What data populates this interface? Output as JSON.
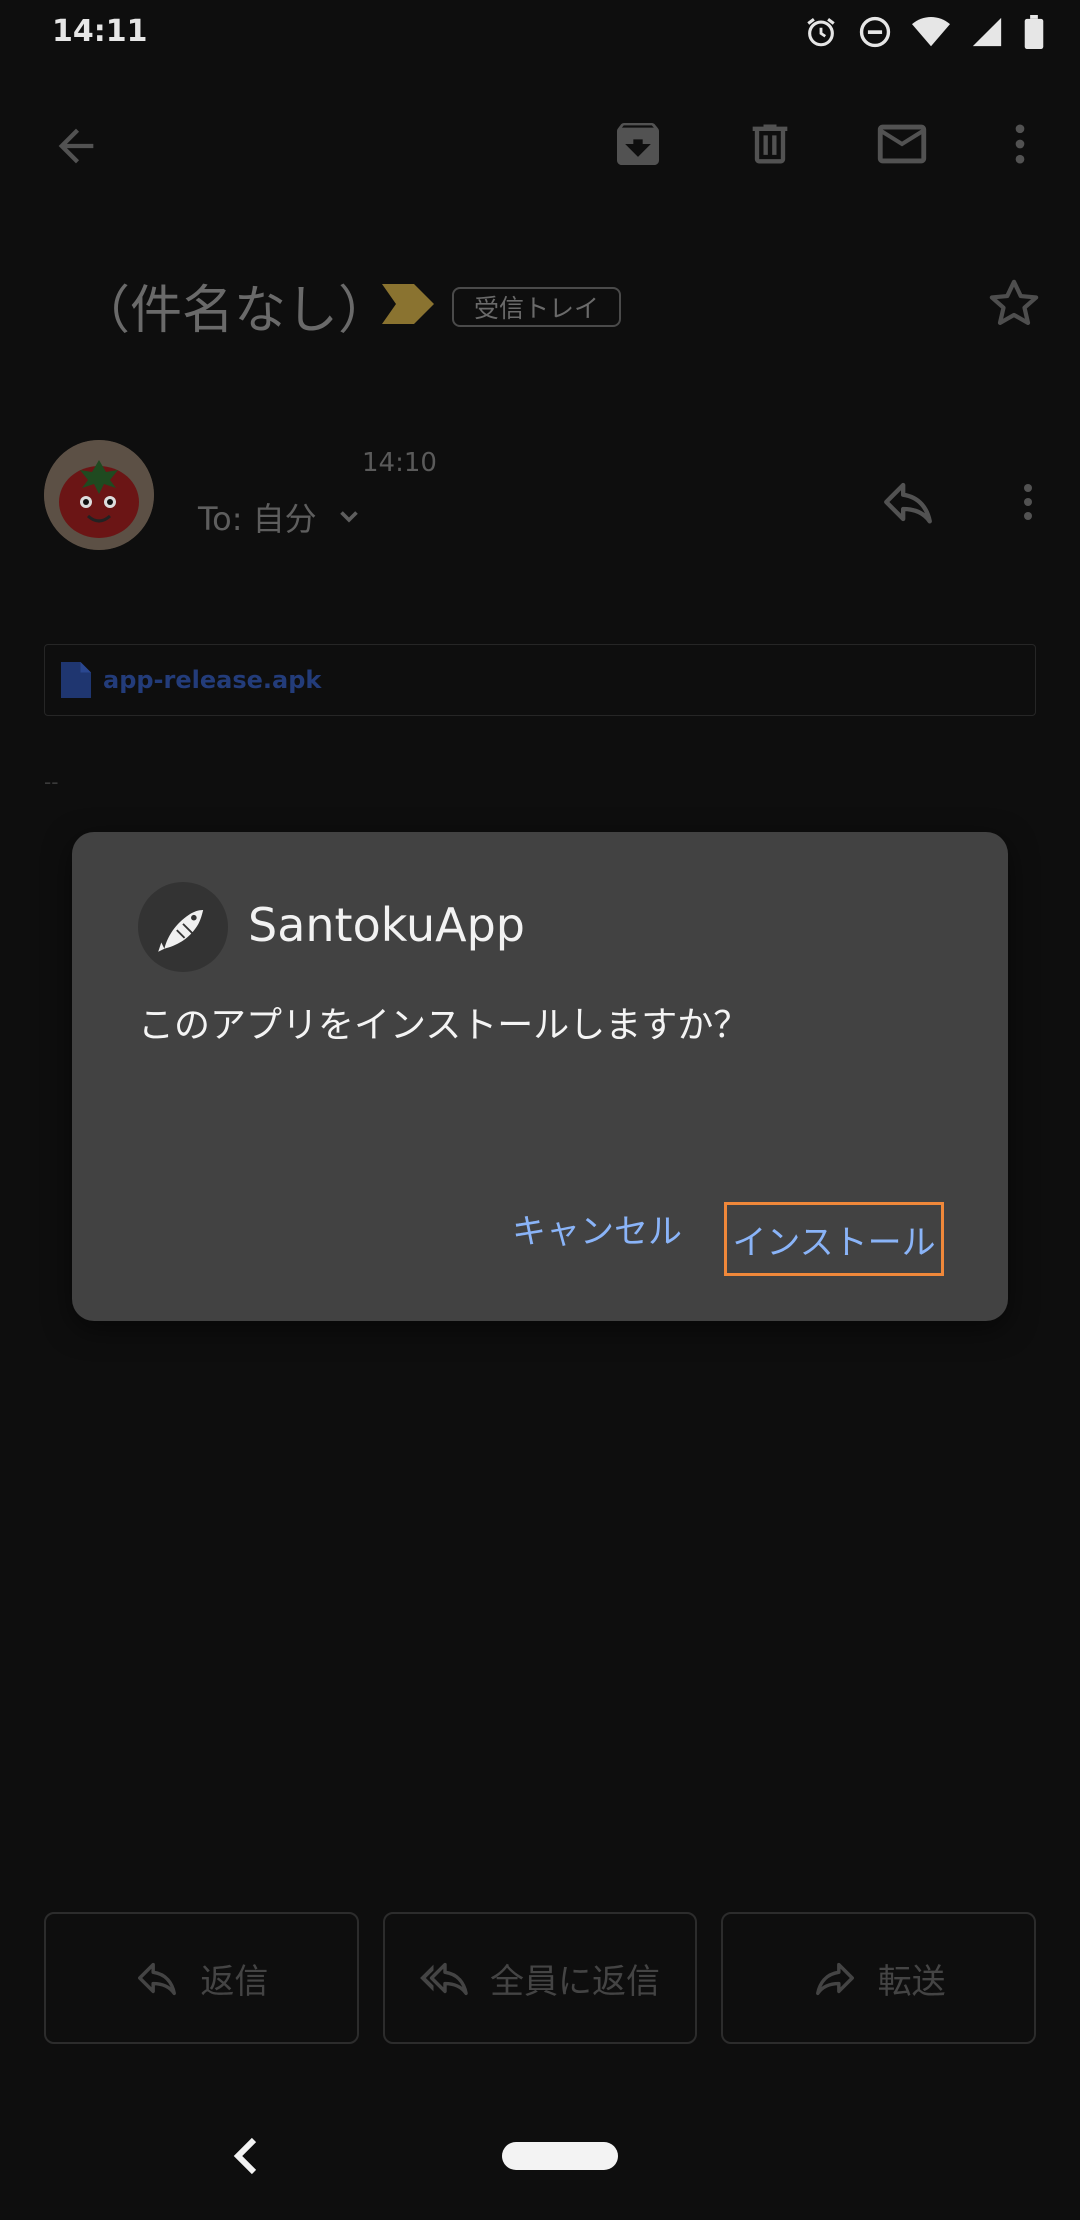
{
  "status_bar": {
    "time": "14:11",
    "icons": [
      "alarm-icon",
      "dnd-icon",
      "wifi-icon",
      "signal-icon",
      "battery-icon"
    ]
  },
  "app_bar": {
    "icons": [
      "back-arrow-icon",
      "archive-icon",
      "delete-icon",
      "mark-unread-icon",
      "more-vert-icon"
    ]
  },
  "email": {
    "subject": "（件名なし）",
    "label": "受信トレイ",
    "sent_time": "14:10",
    "recipient": "To: 自分",
    "attachment": "app-release.apk",
    "signature_dash": "--"
  },
  "bottom_actions": [
    {
      "label": "返信",
      "icon": "reply-icon"
    },
    {
      "label": "全員に返信",
      "icon": "reply-all-icon"
    },
    {
      "label": "転送",
      "icon": "forward-icon"
    }
  ],
  "dialog": {
    "app_name": "SantokuApp",
    "message": "このアプリをインストールしますか？",
    "cancel_label": "キャンセル",
    "install_label": "インストール"
  },
  "colors": {
    "background": "#0e0e0e",
    "dialog_bg": "#424242",
    "button_text": "#8ab4f8",
    "highlight": "#f0883a",
    "label_marker": "#8a7330"
  }
}
